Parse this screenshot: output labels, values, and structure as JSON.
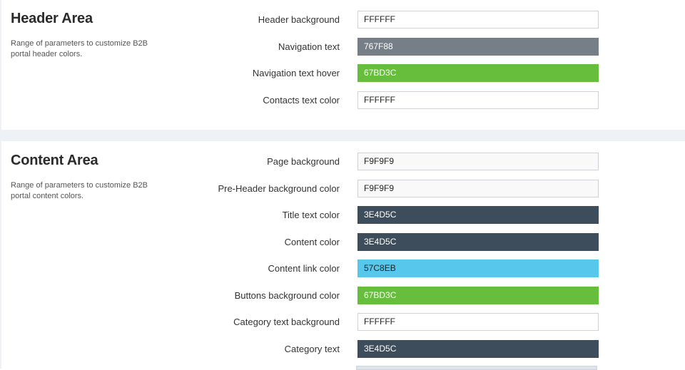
{
  "header_area": {
    "title": "Header Area",
    "description": "Range of parameters to customize B2B portal header colors.",
    "rows": [
      {
        "label": "Header background",
        "value": "FFFFFF",
        "color": "#FFFFFF"
      },
      {
        "label": "Navigation text",
        "value": "767F88",
        "color": "#767F88"
      },
      {
        "label": "Navigation text hover",
        "value": "67BD3C",
        "color": "#67BD3C"
      },
      {
        "label": "Contacts text color",
        "value": "FFFFFF",
        "color": "#FFFFFF"
      }
    ]
  },
  "content_area": {
    "title": "Content Area",
    "description": "Range of parameters to customize B2B portal content colors.",
    "rows": [
      {
        "label": "Page background",
        "value": "F9F9F9",
        "color": "#F9F9F9"
      },
      {
        "label": "Pre-Header background color",
        "value": "F9F9F9",
        "color": "#F9F9F9"
      },
      {
        "label": "Title text color",
        "value": "3E4D5C",
        "color": "#3E4D5C"
      },
      {
        "label": "Content color",
        "value": "3E4D5C",
        "color": "#3E4D5C"
      },
      {
        "label": "Content link color",
        "value": "57C8EB",
        "color": "#57C8EB"
      },
      {
        "label": "Buttons background color",
        "value": "67BD3C",
        "color": "#67BD3C"
      },
      {
        "label": "Category text background",
        "value": "FFFFFF",
        "color": "#FFFFFF"
      },
      {
        "label": "Category text",
        "value": "3E4D5C",
        "color": "#3E4D5C"
      }
    ]
  },
  "theme": {
    "band_color": "#EEF1F5",
    "border_color": "#CFD3D8"
  }
}
